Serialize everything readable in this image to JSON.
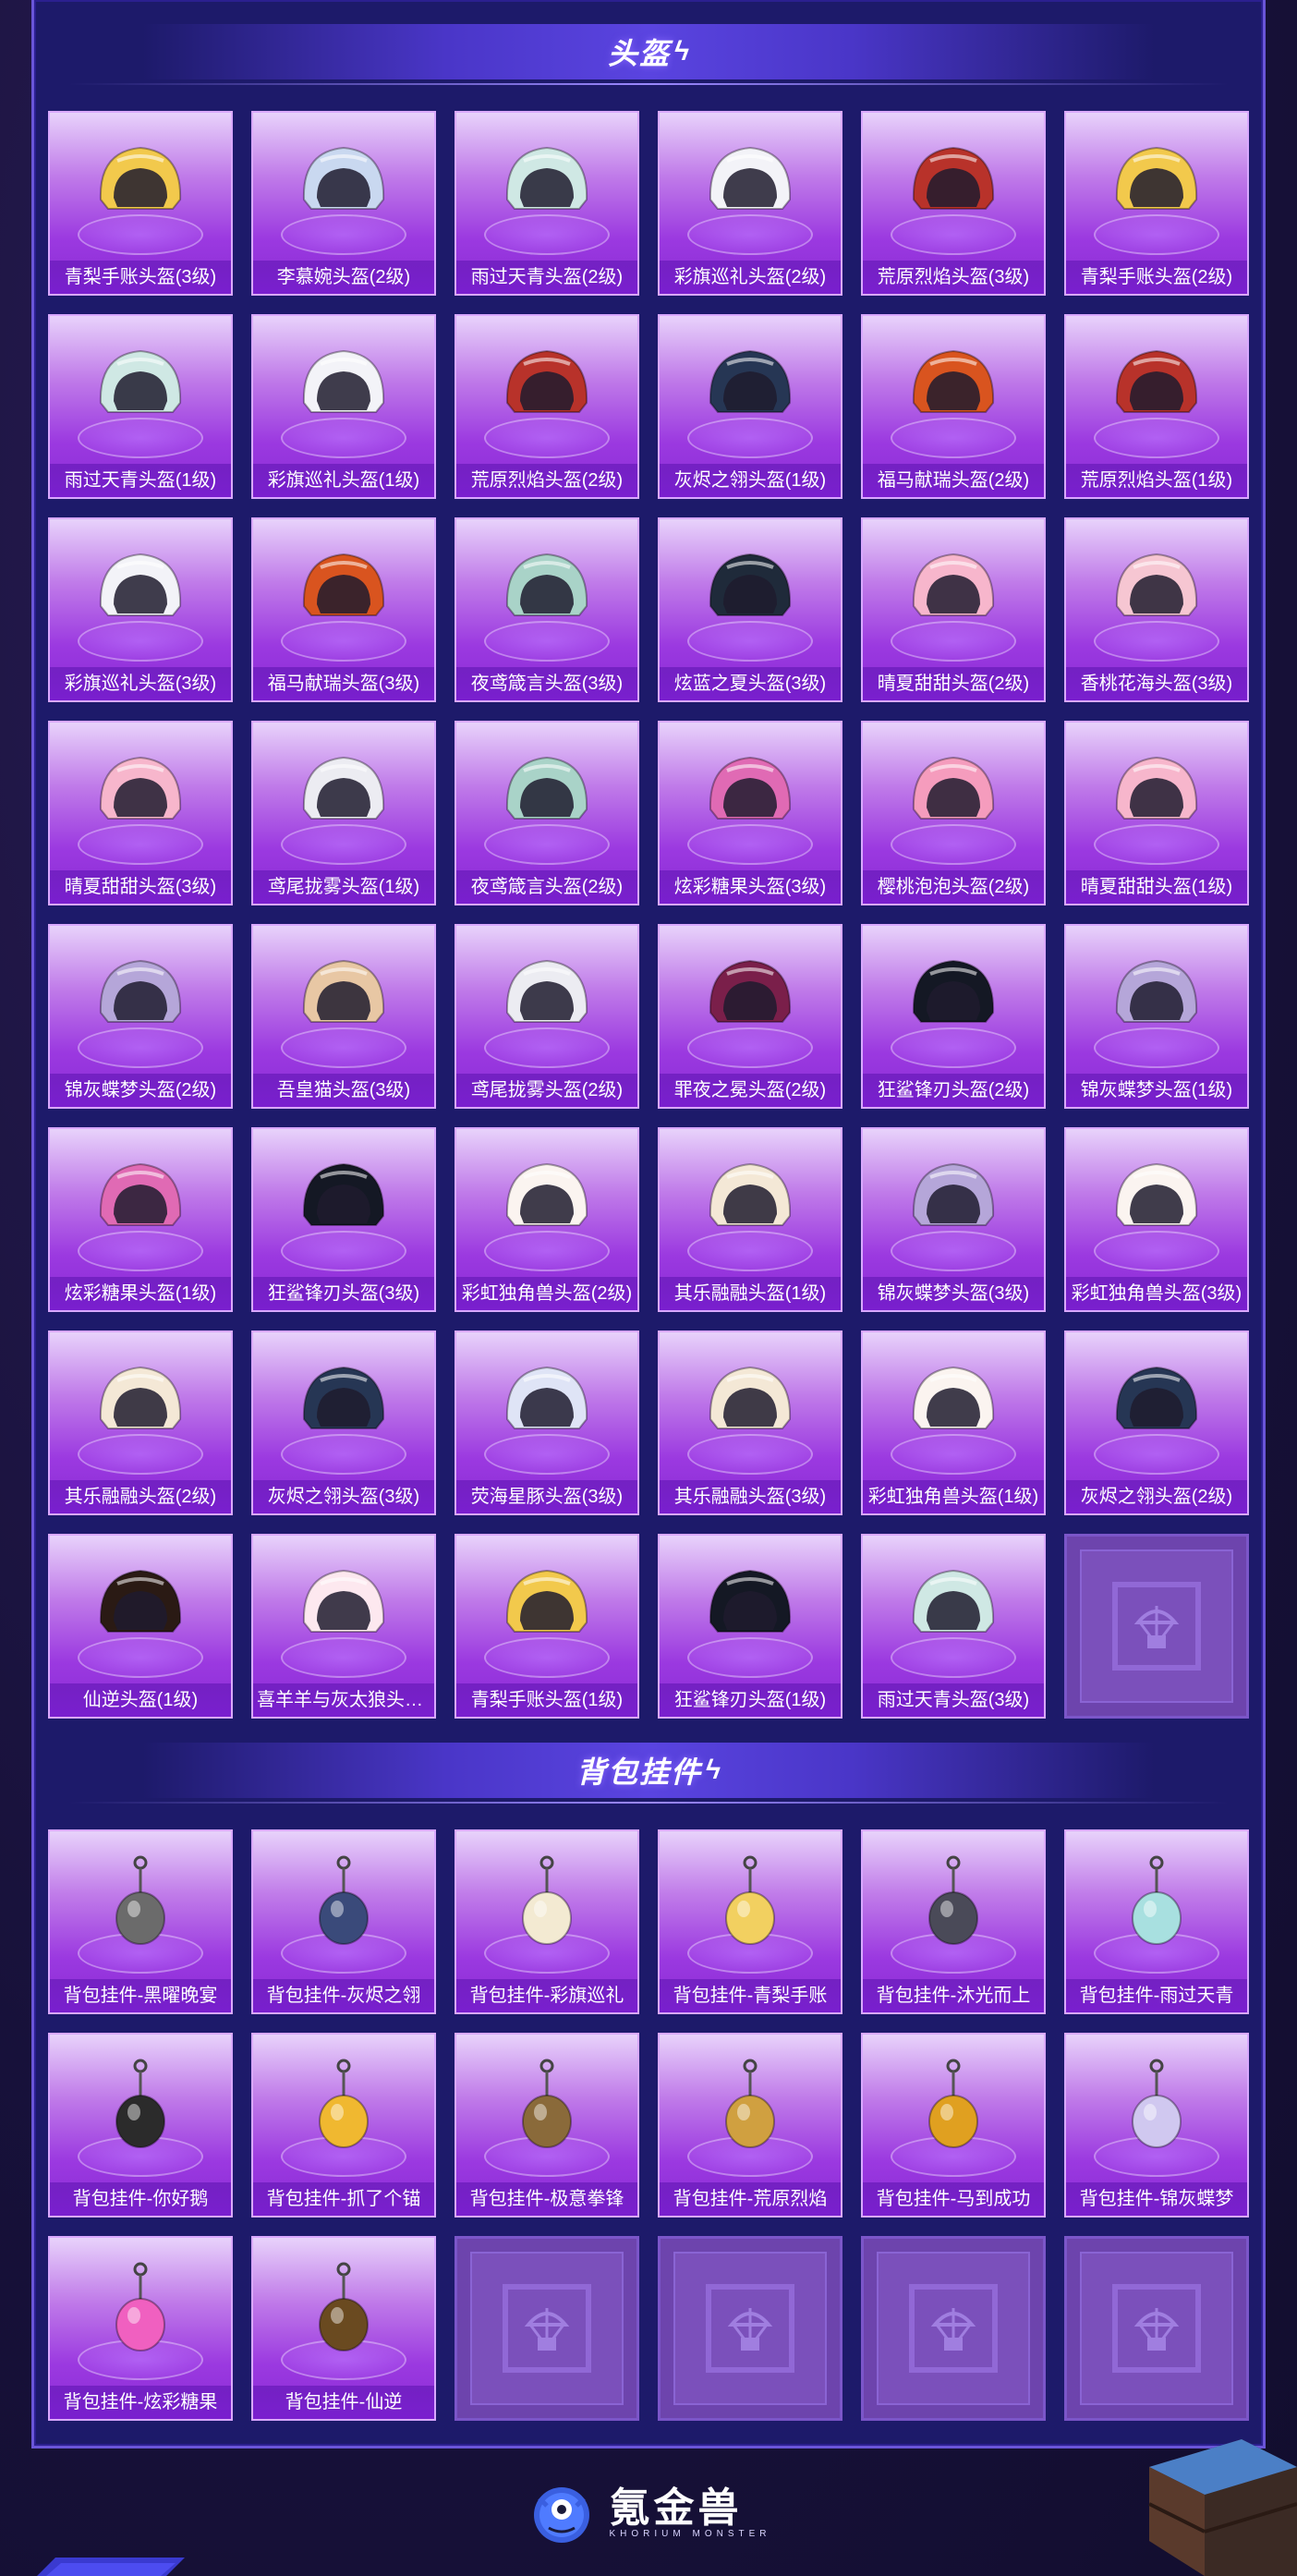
{
  "sections": {
    "helmets": {
      "title": "头盔"
    },
    "charms": {
      "title": "背包挂件"
    }
  },
  "helmets": [
    {
      "label": "青梨手账头盔(3级)",
      "icon": "yellow-pear-helmet-icon",
      "color": "#f2c94c"
    },
    {
      "label": "李慕婉头盔(2级)",
      "icon": "blue-white-helmet-icon",
      "color": "#c9d8f0"
    },
    {
      "label": "雨过天青头盔(2级)",
      "icon": "celadon-helmet-icon",
      "color": "#cfe8e4"
    },
    {
      "label": "彩旗巡礼头盔(2级)",
      "icon": "flag-parade-helmet-icon",
      "color": "#f3f3f8"
    },
    {
      "label": "荒原烈焰头盔(3级)",
      "icon": "flame-helmet-icon",
      "color": "#b8322a"
    },
    {
      "label": "青梨手账头盔(2级)",
      "icon": "yellow-pear-helmet-icon",
      "color": "#f2c94c"
    },
    {
      "label": "雨过天青头盔(1级)",
      "icon": "celadon-helmet-icon",
      "color": "#cfe8e4"
    },
    {
      "label": "彩旗巡礼头盔(1级)",
      "icon": "flag-parade-helmet-icon",
      "color": "#f3f3f8"
    },
    {
      "label": "荒原烈焰头盔(2级)",
      "icon": "flame-helmet-icon",
      "color": "#b8322a"
    },
    {
      "label": "灰烬之翎头盔(1级)",
      "icon": "ash-feather-helmet-icon",
      "color": "#263654"
    },
    {
      "label": "福马献瑞头盔(2级)",
      "icon": "horse-helmet-icon",
      "color": "#d9541f"
    },
    {
      "label": "荒原烈焰头盔(1级)",
      "icon": "flame-helmet-icon",
      "color": "#b8322a"
    },
    {
      "label": "彩旗巡礼头盔(3级)",
      "icon": "flag-parade-helmet-icon",
      "color": "#f3f3f8"
    },
    {
      "label": "福马献瑞头盔(3级)",
      "icon": "horse-helmet-icon",
      "color": "#d9541f"
    },
    {
      "label": "夜鸢箴言头盔(3级)",
      "icon": "owl-helmet-icon",
      "color": "#a9d3c8"
    },
    {
      "label": "炫蓝之夏头盔(3级)",
      "icon": "blue-summer-helmet-icon",
      "color": "#1f2a3a"
    },
    {
      "label": "晴夏甜甜头盔(2级)",
      "icon": "pink-sweet-helmet-icon",
      "color": "#f7b6cc"
    },
    {
      "label": "香桃花海头盔(3级)",
      "icon": "peach-helmet-icon",
      "color": "#f6c6d2"
    },
    {
      "label": "晴夏甜甜头盔(3级)",
      "icon": "pink-sweet-helmet-icon",
      "color": "#f7b6cc"
    },
    {
      "label": "鸢尾拢雾头盔(1级)",
      "icon": "iris-mist-helmet-icon",
      "color": "#ececf2"
    },
    {
      "label": "夜鸢箴言头盔(2级)",
      "icon": "owl-helmet-icon",
      "color": "#a9d3c8"
    },
    {
      "label": "炫彩糖果头盔(3级)",
      "icon": "candy-helmet-icon",
      "color": "#e06ab4"
    },
    {
      "label": "樱桃泡泡头盔(2级)",
      "icon": "cherry-bubble-helmet-icon",
      "color": "#f59cbd"
    },
    {
      "label": "晴夏甜甜头盔(1级)",
      "icon": "pink-sweet-helmet-icon",
      "color": "#f7b6cc"
    },
    {
      "label": "锦灰蝶梦头盔(2级)",
      "icon": "butterfly-helmet-icon",
      "color": "#b5a6d9"
    },
    {
      "label": "吾皇猫头盔(3级)",
      "icon": "cat-helmet-icon",
      "color": "#e8c7a4"
    },
    {
      "label": "鸢尾拢雾头盔(2级)",
      "icon": "iris-mist-helmet-icon",
      "color": "#ececf2"
    },
    {
      "label": "罪夜之冕头盔(2级)",
      "icon": "night-crown-helmet-icon",
      "color": "#7a1f4a"
    },
    {
      "label": "狂鲨锋刃头盔(2级)",
      "icon": "shark-helmet-icon",
      "color": "#141824"
    },
    {
      "label": "锦灰蝶梦头盔(1级)",
      "icon": "butterfly-helmet-icon",
      "color": "#b5a6d9"
    },
    {
      "label": "炫彩糖果头盔(1级)",
      "icon": "candy-helmet-icon",
      "color": "#e06ab4"
    },
    {
      "label": "狂鲨锋刃头盔(3级)",
      "icon": "shark-helmet-icon",
      "color": "#141824"
    },
    {
      "label": "彩虹独角兽头盔(2级)",
      "icon": "unicorn-helmet-icon",
      "color": "#fbf4f0"
    },
    {
      "label": "其乐融融头盔(1级)",
      "icon": "joyful-helmet-icon",
      "color": "#f4e8d6"
    },
    {
      "label": "锦灰蝶梦头盔(3级)",
      "icon": "butterfly-helmet-icon",
      "color": "#b5a6d9"
    },
    {
      "label": "彩虹独角兽头盔(3级)",
      "icon": "unicorn-helmet-icon",
      "color": "#fbf4f0"
    },
    {
      "label": "其乐融融头盔(2级)",
      "icon": "joyful-helmet-icon",
      "color": "#f4e8d6"
    },
    {
      "label": "灰烬之翎头盔(3级)",
      "icon": "ash-feather-helmet-icon",
      "color": "#263654"
    },
    {
      "label": "荧海星豚头盔(3级)",
      "icon": "dolphin-helmet-icon",
      "color": "#dfe4f6"
    },
    {
      "label": "其乐融融头盔(3级)",
      "icon": "joyful-helmet-icon",
      "color": "#f4e8d6"
    },
    {
      "label": "彩虹独角兽头盔(1级)",
      "icon": "unicorn-helmet-icon",
      "color": "#fbf4f0"
    },
    {
      "label": "灰烬之翎头盔(2级)",
      "icon": "ash-feather-helmet-icon",
      "color": "#263654"
    },
    {
      "label": "仙逆头盔(1级)",
      "icon": "immortal-helmet-icon",
      "color": "#2a1a14"
    },
    {
      "label": "喜羊羊与灰太狼头盔...",
      "icon": "sheep-helmet-icon",
      "color": "#fde8ef"
    },
    {
      "label": "青梨手账头盔(1级)",
      "icon": "yellow-pear-helmet-icon",
      "color": "#f2c94c"
    },
    {
      "label": "狂鲨锋刃头盔(1级)",
      "icon": "shark-helmet-icon",
      "color": "#141824"
    },
    {
      "label": "雨过天青头盔(3级)",
      "icon": "celadon-helmet-icon",
      "color": "#cfe8e4"
    },
    {
      "label": "",
      "icon": "airdrop-crate-icon",
      "empty": true
    }
  ],
  "charms": [
    {
      "label": "背包挂件-黑曜晚宴",
      "icon": "obsidian-charm-icon",
      "color": "#6b6b6b"
    },
    {
      "label": "背包挂件-灰烬之翎",
      "icon": "ash-feather-charm-icon",
      "color": "#3a4a7a"
    },
    {
      "label": "背包挂件-彩旗巡礼",
      "icon": "ice-cream-charm-icon",
      "color": "#f3ead2"
    },
    {
      "label": "背包挂件-青梨手账",
      "icon": "pear-charm-icon",
      "color": "#f2d060"
    },
    {
      "label": "背包挂件-沐光而上",
      "icon": "cat-charm-icon",
      "color": "#4a4a58"
    },
    {
      "label": "背包挂件-雨过天青",
      "icon": "sword-charm-icon",
      "color": "#a8e0e0"
    },
    {
      "label": "背包挂件-你好鹅",
      "icon": "penguin-charm-icon",
      "color": "#2b2b2b"
    },
    {
      "label": "背包挂件-抓了个锚",
      "icon": "anchor-charm-icon",
      "color": "#f0b830"
    },
    {
      "label": "背包挂件-极意拳锋",
      "icon": "fist-charm-icon",
      "color": "#8a6a3a"
    },
    {
      "label": "背包挂件-荒原烈焰",
      "icon": "sun-charm-icon",
      "color": "#d0a040"
    },
    {
      "label": "背包挂件-马到成功",
      "icon": "horse-charm-icon",
      "color": "#e0a020"
    },
    {
      "label": "背包挂件-锦灰蝶梦",
      "icon": "butterfly-charm-icon",
      "color": "#d0c8f0"
    },
    {
      "label": "背包挂件-炫彩糖果",
      "icon": "lollipop-charm-icon",
      "color": "#f060c0"
    },
    {
      "label": "背包挂件-仙逆",
      "icon": "immortal-charm-icon",
      "color": "#6a4a20"
    },
    {
      "label": "",
      "icon": "airdrop-crate-icon",
      "empty": true
    },
    {
      "label": "",
      "icon": "airdrop-crate-icon",
      "empty": true
    },
    {
      "label": "",
      "icon": "airdrop-crate-icon",
      "empty": true
    },
    {
      "label": "",
      "icon": "airdrop-crate-icon",
      "empty": true
    }
  ],
  "footer": {
    "brand": "氪金兽",
    "brand_sub": "KHORIUM MONSTER",
    "mascot_icon": "monster-mascot-icon"
  }
}
